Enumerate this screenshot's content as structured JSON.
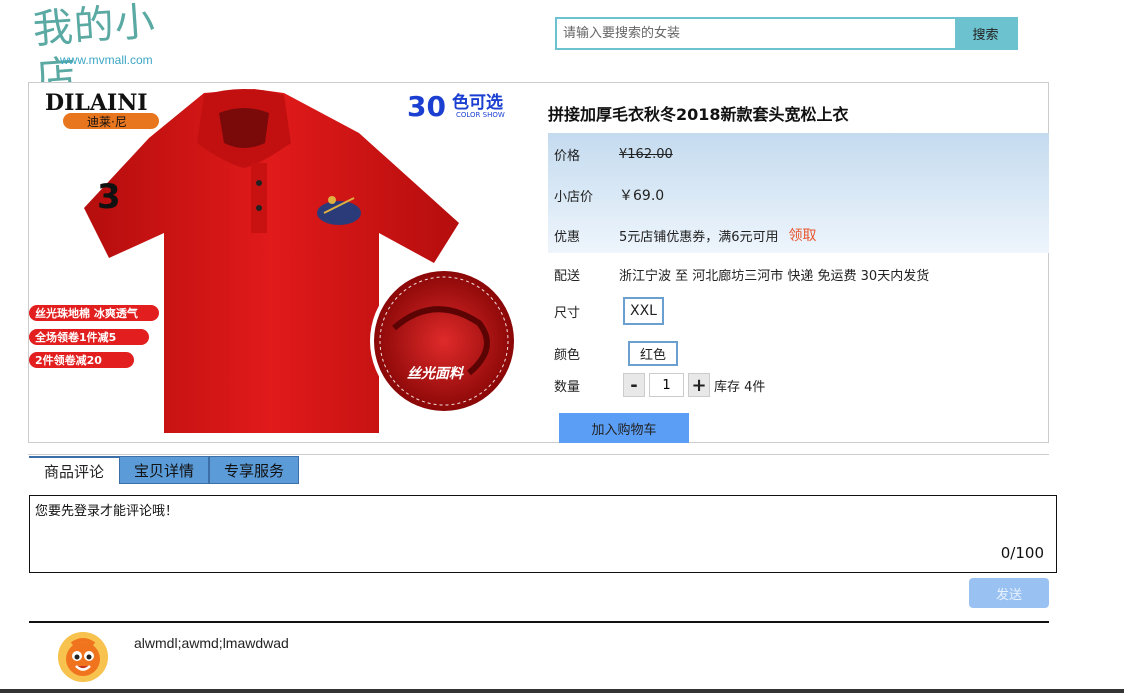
{
  "brand": {
    "logo": "我的小店",
    "url": "www.mvmall.com"
  },
  "search": {
    "placeholder": "请输入要搜索的女装",
    "button": "搜索"
  },
  "product_image": {
    "brand_en": "DILAINI",
    "brand_cn": "迪莱·尼",
    "color_count": "30",
    "color_label": "色可选",
    "color_show": "COLOR SHOW",
    "badges": [
      "丝光珠地棉 冰爽透气",
      "全场领卷1件减5",
      "2件领卷减20"
    ],
    "fabric_label": "丝光面料",
    "colors": {
      "shirt": "#d81414",
      "badge": "#e21e1e"
    }
  },
  "product": {
    "title": "拼接加厚毛衣秋冬2018新款套头宽松上衣",
    "price_label": "价格",
    "price": "¥162.00",
    "shop_price_label": "小店价",
    "shop_price": "￥69.0",
    "discount_label": "优惠",
    "discount_text": "5元店铺优惠券，满6元可用",
    "claim": "领取",
    "shipping_label": "配送",
    "shipping_text": "浙江宁波 至 河北廊坊三河市 快递 免运费 30天内发货",
    "size_label": "尺寸",
    "size": "XXL",
    "color_label": "颜色",
    "color": "红色",
    "qty_label": "数量",
    "qty_minus": "-",
    "qty": "1",
    "qty_plus": "+",
    "stock": "库存 4件",
    "add_cart": "加入购物车"
  },
  "tabs": [
    {
      "label": "商品评论",
      "active": true
    },
    {
      "label": "宝贝详情",
      "active": false
    },
    {
      "label": "专享服务",
      "active": false
    }
  ],
  "comment": {
    "text": "您要先登录才能评论哦！",
    "counter": "0/100",
    "send": "发送"
  },
  "comments": [
    {
      "text": "alwmdl;awmd;lmawdwad"
    }
  ]
}
